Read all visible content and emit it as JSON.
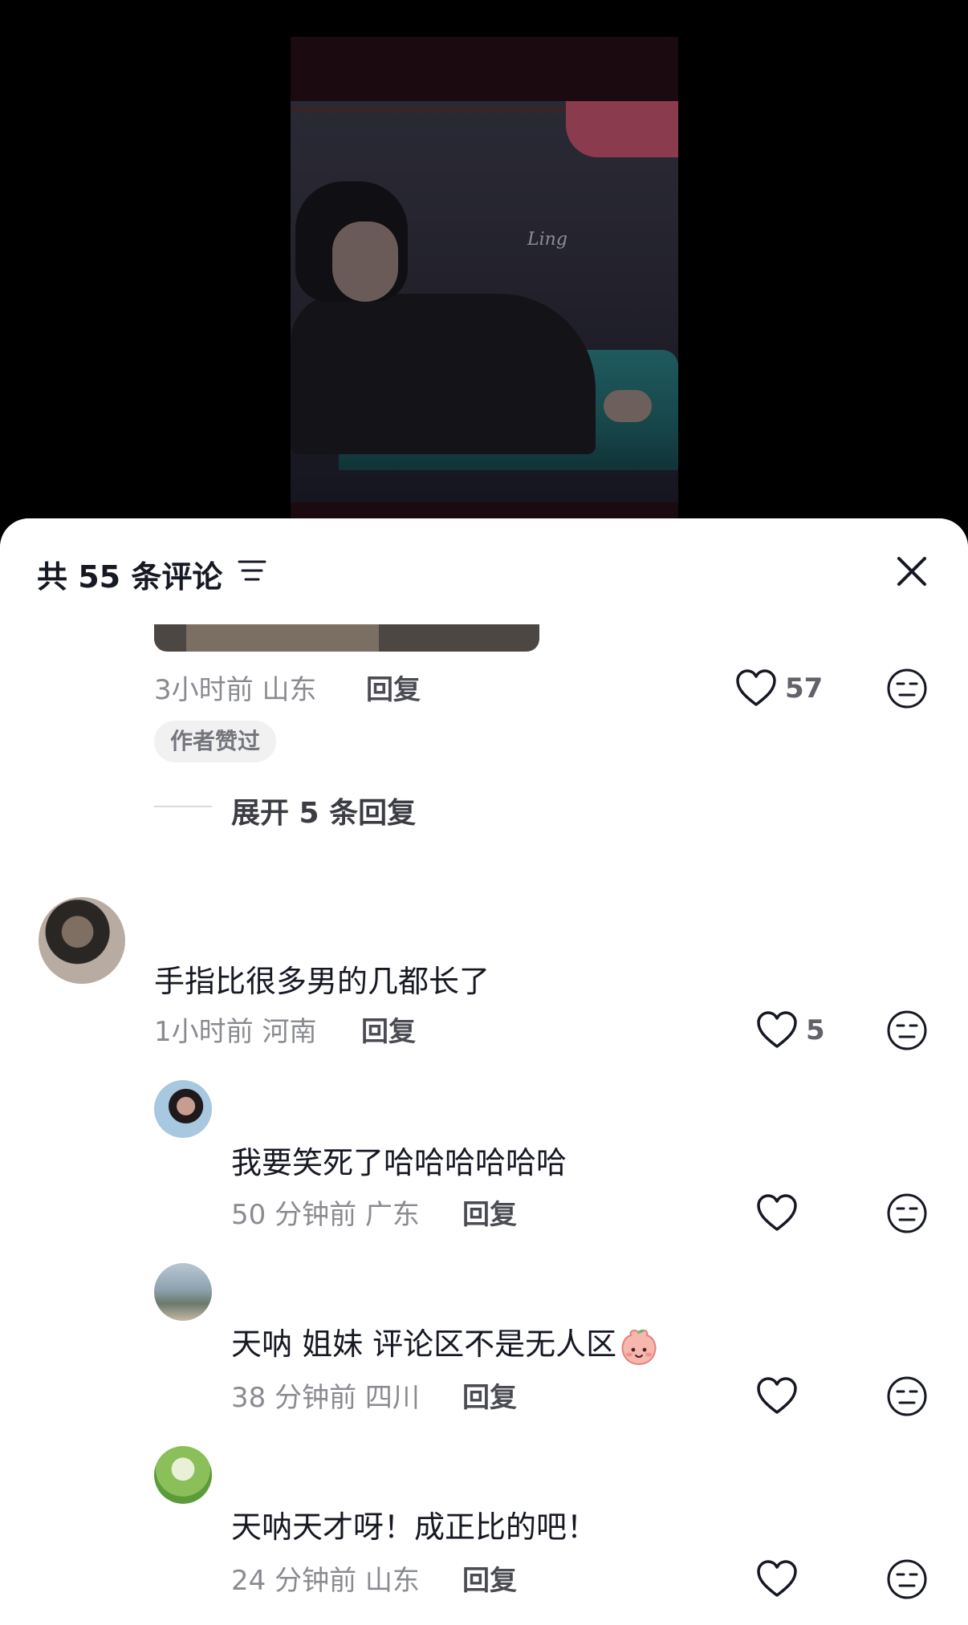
{
  "video": {
    "signature": "Ling"
  },
  "header": {
    "title": "共 55 条评论"
  },
  "comments": [
    {
      "time": "3小时前",
      "location": "山东",
      "reply": "回复",
      "likes": "57",
      "author_liked": "作者赞过",
      "expand": "展开 5 条回复"
    },
    {
      "text": "手指比很多男的几都长了",
      "time": "1小时前",
      "location": "河南",
      "reply": "回复",
      "likes": "5",
      "replies": [
        {
          "text": "我要笑死了哈哈哈哈哈哈",
          "time": "50 分钟前",
          "location": "广东",
          "reply": "回复"
        },
        {
          "text": "天呐 姐妹 评论区不是无人区",
          "time": "38 分钟前",
          "location": "四川",
          "reply": "回复"
        },
        {
          "text": "天呐天才呀！成正比的吧！",
          "time": "24 分钟前",
          "location": "山东",
          "reply": "回复"
        }
      ]
    }
  ]
}
